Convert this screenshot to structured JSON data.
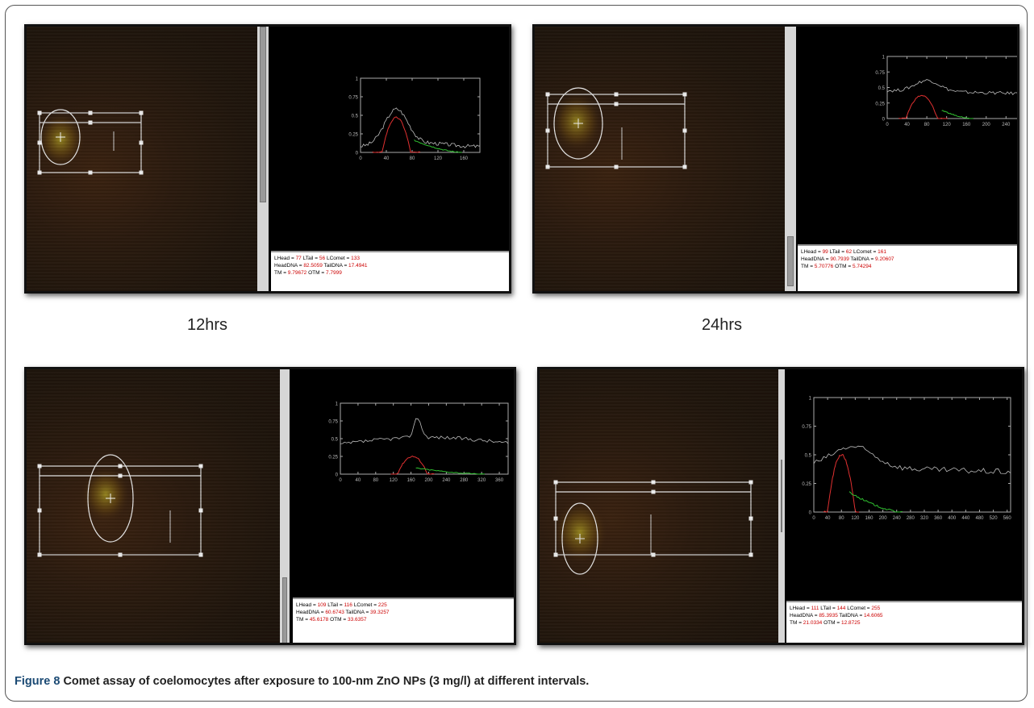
{
  "panels": [
    {
      "label": "12hrs",
      "stats": {
        "lhead": "99",
        "ltail": "62",
        "lcomet": "161",
        "headdna": "90.7939",
        "taildna": "9.20607",
        "tm": "5.70776",
        "otm": "5.74294"
      }
    },
    {
      "label": "",
      "stats": {
        "lhead": "77",
        "ltail": "56",
        "lcomet": "133",
        "headdna": "82.5059",
        "taildna": "17.4941",
        "tm": "9.79672",
        "otm": "7.7999"
      }
    },
    {
      "label": "24hrs",
      "stats": {
        "lhead": "109",
        "ltail": "116",
        "lcomet": "225",
        "headdna": "60.6743",
        "taildna": "39.3257",
        "tm": "45.6178",
        "otm": "33.6357"
      }
    },
    {
      "label": "",
      "stats": {
        "lhead": "111",
        "ltail": "144",
        "lcomet": "255",
        "headdna": "85.3935",
        "taildna": "14.6065",
        "tm": "21.0334",
        "otm": "12.8725"
      }
    }
  ],
  "panel_captions": [
    "12hrs",
    "24hrs"
  ],
  "figure_caption": {
    "label": "Figure 8",
    "text": "Comet assay of coelomocytes after exposure to 100-nm ZnO NPs (3 mg/l) at different intervals."
  },
  "stat_labels": {
    "lhead": "LHead = ",
    "ltail": "LTail = ",
    "lcomet": "LComet = ",
    "headdna": "HeadDNA = ",
    "taildna": "TailDNA = ",
    "tm": "TM = ",
    "otm": "OTM = "
  },
  "chart_data": [
    {
      "type": "line",
      "x_ticks": [
        "0",
        "40",
        "80",
        "120",
        "160"
      ],
      "y_ticks": [
        "0",
        "0.25",
        "0.5",
        "0.75",
        "1"
      ],
      "ylim": [
        0,
        1
      ],
      "xlim": [
        0,
        185
      ]
    },
    {
      "type": "line",
      "x_ticks": [
        "0",
        "40",
        "80",
        "120",
        "160",
        "200",
        "240"
      ],
      "y_ticks": [
        "0",
        "0.25",
        "0.5",
        "0.75",
        "1"
      ],
      "ylim": [
        0,
        1
      ],
      "xlim": [
        0,
        290
      ]
    },
    {
      "type": "line",
      "x_ticks": [
        "0",
        "40",
        "80",
        "120",
        "160",
        "200",
        "240",
        "280",
        "320",
        "360"
      ],
      "y_ticks": [
        "0",
        "0.25",
        "0.5",
        "0.75",
        "1"
      ],
      "ylim": [
        0,
        1
      ],
      "xlim": [
        0,
        380
      ]
    },
    {
      "type": "line",
      "x_ticks": [
        "0",
        "40",
        "80",
        "120",
        "160",
        "200",
        "240",
        "280",
        "320",
        "360",
        "400",
        "440",
        "480",
        "520",
        "560"
      ],
      "y_ticks": [
        "0",
        "0.25",
        "0.5",
        "0.75",
        "1"
      ],
      "ylim": [
        0,
        1
      ],
      "xlim": [
        0,
        570
      ]
    }
  ]
}
